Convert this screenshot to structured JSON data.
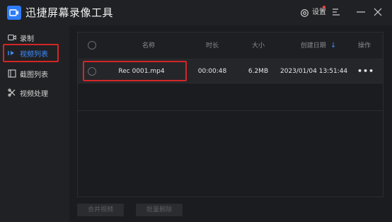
{
  "app": {
    "title": "迅捷屏幕录像工具",
    "settings_label": "设置"
  },
  "sidebar": {
    "items": [
      {
        "label": "录制",
        "icon": "record-icon",
        "active": false
      },
      {
        "label": "视频列表",
        "icon": "video-list-icon",
        "active": true
      },
      {
        "label": "截图列表",
        "icon": "screenshot-list-icon",
        "active": false
      },
      {
        "label": "视频处理",
        "icon": "video-process-icon",
        "active": false
      }
    ]
  },
  "table": {
    "columns": {
      "name": "名称",
      "duration": "时长",
      "size": "大小",
      "created": "创建日期",
      "actions": "操作"
    },
    "rows": [
      {
        "name": "Rec 0001.mp4",
        "duration": "00:00:48",
        "size": "6.2MB",
        "created": "2023/01/04 13:51:44",
        "actions": "•••"
      }
    ]
  },
  "footer": {
    "merge_label": "合并视频",
    "batch_delete_label": "批量删除"
  },
  "colors": {
    "accent": "#3d8cff",
    "highlight": "#d32626",
    "background": "#1b1c1f",
    "sidebar": "#202124"
  }
}
